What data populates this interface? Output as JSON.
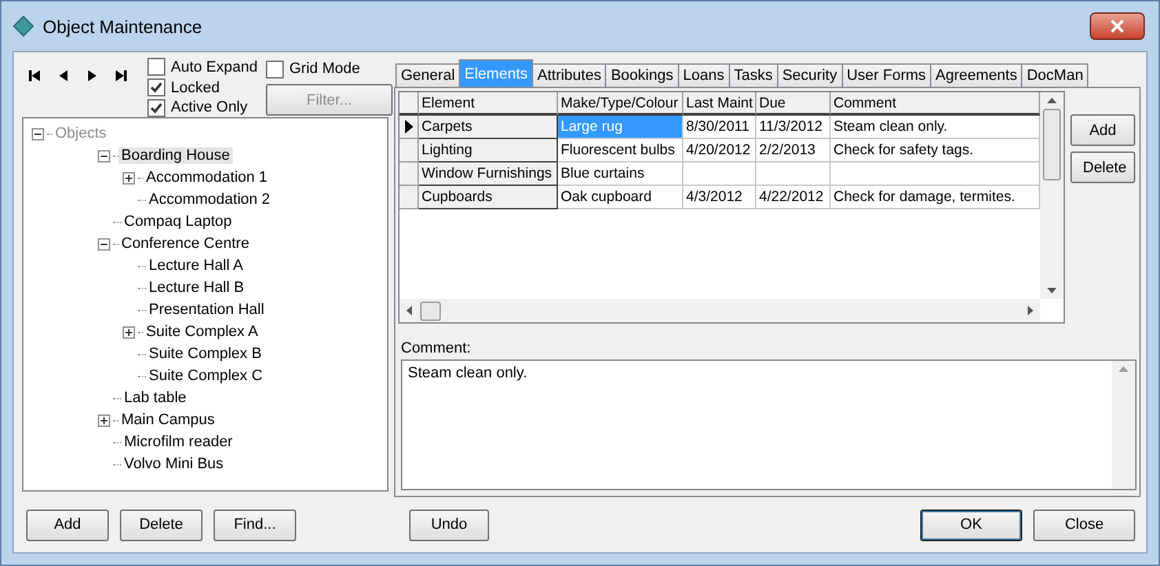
{
  "window": {
    "title": "Object Maintenance"
  },
  "options": [
    {
      "label": "Auto Expand",
      "checked": false
    },
    {
      "label": "Locked",
      "checked": true
    },
    {
      "label": "Active Only",
      "checked": true
    }
  ],
  "grid_mode": {
    "label": "Grid Mode",
    "checked": false
  },
  "filter_button": {
    "label": "Filter...",
    "disabled": true
  },
  "tree": {
    "root": {
      "label": "Objects",
      "expanded": true,
      "children": [
        {
          "label": "Boarding House",
          "selected": true,
          "expanded": true,
          "children": [
            {
              "label": "Accommodation 1",
              "selected": false,
              "expanded": false
            },
            {
              "label": "Accommodation 2",
              "selected": false
            }
          ]
        },
        {
          "label": "Compaq Laptop",
          "selected": false
        },
        {
          "label": "Conference Centre",
          "selected": false,
          "expanded": true,
          "children": [
            {
              "label": "Lecture Hall A",
              "selected": false
            },
            {
              "label": "Lecture Hall B",
              "selected": false
            },
            {
              "label": "Presentation Hall",
              "selected": false
            },
            {
              "label": "Suite Complex A",
              "selected": false,
              "expanded": false
            },
            {
              "label": "Suite Complex B",
              "selected": false
            },
            {
              "label": "Suite Complex C",
              "selected": false
            }
          ]
        },
        {
          "label": "Lab table",
          "selected": false
        },
        {
          "label": "Main Campus",
          "selected": false,
          "expanded": false
        },
        {
          "label": "Microfilm reader",
          "selected": false
        },
        {
          "label": "Volvo Mini Bus",
          "selected": false
        }
      ]
    }
  },
  "tabs": [
    {
      "label": "General",
      "selected": false
    },
    {
      "label": "Elements",
      "selected": true
    },
    {
      "label": "Attributes",
      "selected": false
    },
    {
      "label": "Bookings",
      "selected": false
    },
    {
      "label": "Loans",
      "selected": false
    },
    {
      "label": "Tasks",
      "selected": false
    },
    {
      "label": "Security",
      "selected": false
    },
    {
      "label": "User Forms",
      "selected": false
    },
    {
      "label": "Agreements",
      "selected": false
    },
    {
      "label": "DocMan",
      "selected": false
    }
  ],
  "table": {
    "columns": [
      "Element",
      "Make/Type/Colour",
      "Last Maint",
      "Due",
      "Comment"
    ],
    "rows": [
      {
        "current": true,
        "cells": [
          {
            "text": "Carpets",
            "selected": false
          },
          {
            "text": "Large rug",
            "selected": true
          },
          {
            "text": "8/30/2011",
            "selected": false
          },
          {
            "text": "11/3/2012",
            "selected": false
          },
          {
            "text": "Steam clean only.",
            "selected": false
          }
        ]
      },
      {
        "current": false,
        "cells": [
          {
            "text": "Lighting",
            "selected": false
          },
          {
            "text": "Fluorescent bulbs",
            "selected": false
          },
          {
            "text": "4/20/2012",
            "selected": false
          },
          {
            "text": "2/2/2013",
            "selected": false
          },
          {
            "text": "Check for safety tags.",
            "selected": false
          }
        ]
      },
      {
        "current": false,
        "cells": [
          {
            "text": "Window Furnishings",
            "selected": false
          },
          {
            "text": "Blue curtains",
            "selected": false
          },
          {
            "selected": false
          },
          {
            "selected": false
          },
          {
            "selected": false
          }
        ]
      },
      {
        "current": false,
        "cells": [
          {
            "text": "Cupboards",
            "selected": false
          },
          {
            "text": "Oak cupboard",
            "selected": false
          },
          {
            "text": "4/3/2012",
            "selected": false
          },
          {
            "text": "4/22/2012",
            "selected": false
          },
          {
            "text": "Check for damage, termites.",
            "selected": false
          }
        ]
      }
    ]
  },
  "side_buttons": [
    "Add",
    "Delete"
  ],
  "comment": {
    "label": "Comment:",
    "value": "Steam clean only."
  },
  "bottom_left_buttons": [
    "Add",
    "Delete",
    "Find...",
    "Undo"
  ],
  "bottom_right_buttons": [
    {
      "label": "OK",
      "default": true
    },
    {
      "label": "Close",
      "default": false
    }
  ]
}
